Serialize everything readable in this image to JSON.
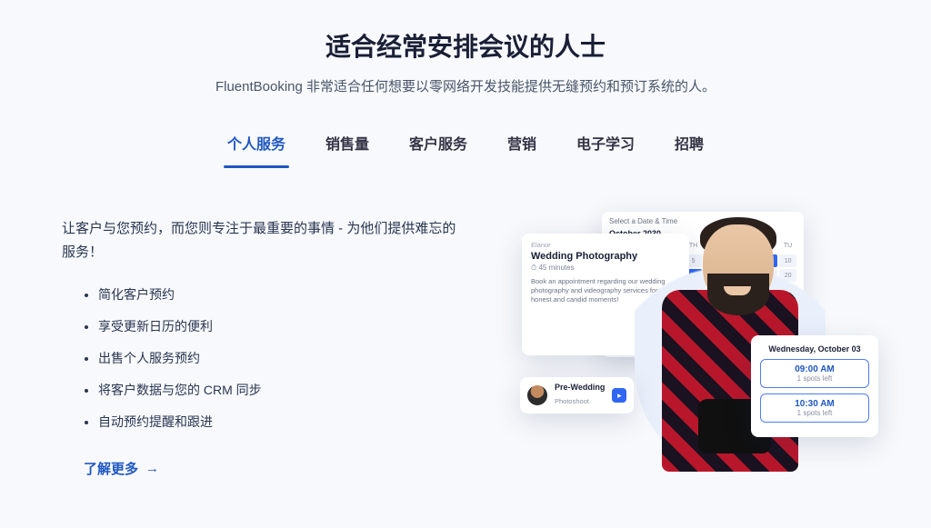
{
  "header": {
    "title": "适合经常安排会议的人士",
    "subtitle": "FluentBooking 非常适合任何想要以零网络开发技能提供无缝预约和预订系统的人。"
  },
  "tabs": [
    "个人服务",
    "销售量",
    "客户服务",
    "营销",
    "电子学习",
    "招聘"
  ],
  "activeTab": 0,
  "panel": {
    "lead": "让客户与您预约，而您则专注于最重要的事情 - 为他们提供难忘的服务！",
    "bullets": [
      "简化客户预约",
      "享受更新日历的便利",
      "出售个人服务预约",
      "将客户数据与您的 CRM 同步",
      "自动预约提醒和跟进"
    ],
    "more": "了解更多"
  },
  "illus": {
    "serviceOwner": "Elanor",
    "serviceName": "Wedding Photography",
    "minutes": "45 minutes",
    "serviceDesc": "Book an appointment regarding our wedding photography and videography services for honest and candid moments!",
    "dtTitle": "Select a Date & Time",
    "month": "October 2030",
    "miniTitle": "Pre-Wedding",
    "miniSub": "Photoshoot",
    "dateLabel": "Wednesday, October 03",
    "slots": [
      {
        "t": "09:00 AM",
        "s": "1 spots left"
      },
      {
        "t": "10:30 AM",
        "s": "1 spots left"
      }
    ]
  }
}
